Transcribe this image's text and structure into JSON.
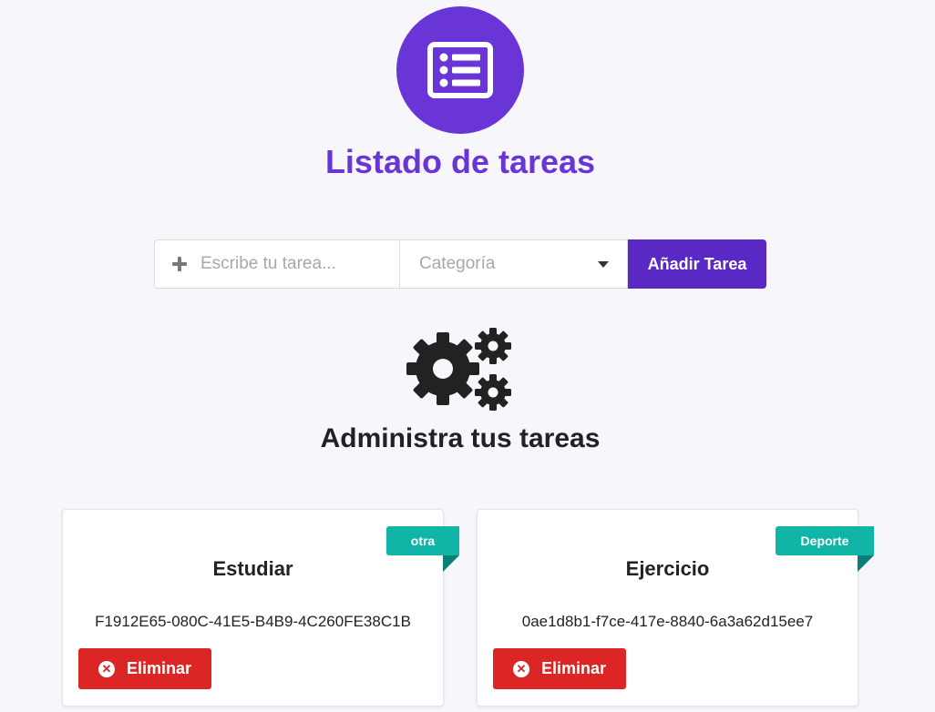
{
  "header": {
    "title": "Listado de tareas",
    "icon": "list-alt-icon",
    "accent_color": "#6a35d6"
  },
  "form": {
    "task_placeholder": "Escribe tu tarea...",
    "task_value": "",
    "category_placeholder": "Categoría",
    "add_button_label": "Añadir Tarea",
    "add_button_color": "#5a28c4"
  },
  "admin": {
    "icon": "cogs-icon",
    "title": "Administra tus tareas"
  },
  "tasks": [
    {
      "title": "Estudiar",
      "id": "F1912E65-080C-41E5-B4B9-4C260FE38C1B",
      "category": "otra",
      "delete_label": "Eliminar"
    },
    {
      "title": "Ejercicio",
      "id": "0ae1d8b1-f7ce-417e-8840-6a3a62d15ee7",
      "category": "Deporte",
      "delete_label": "Eliminar"
    }
  ],
  "colors": {
    "ribbon": "#10b5a8",
    "delete": "#dc2626"
  }
}
